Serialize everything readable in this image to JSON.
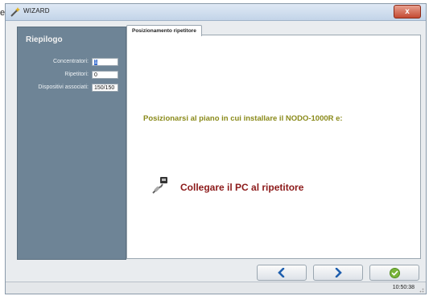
{
  "edge_fragment": "e",
  "window": {
    "title": "WIZARD",
    "close_glyph": "x"
  },
  "sidebar": {
    "title": "Riepilogo",
    "rows": [
      {
        "label": "Concentratori:",
        "value": "1"
      },
      {
        "label": "Ripetitori:",
        "value": "0"
      },
      {
        "label": "Dispositivi associati:",
        "value": "150/150"
      }
    ]
  },
  "tab": {
    "label": "Posizionamento ripetitore"
  },
  "content": {
    "instruction": "Posizionarsi al piano in cui installare il NODO-1000R e:",
    "step_icon": "ethernet-plug-icon",
    "step_text": "Collegare il PC al ripetitore"
  },
  "buttons": {
    "back_icon": "chevron-left-icon",
    "next_icon": "chevron-right-icon",
    "finish_icon": "check-circle-icon"
  },
  "statusbar": {
    "time": "10:50:38"
  },
  "colors": {
    "sidebar_bg": "#6e8496",
    "instruction": "#8a8a1a",
    "step_text": "#8c1a1a",
    "nav_arrow": "#1f5fae",
    "finish_green": "#79b43a"
  }
}
